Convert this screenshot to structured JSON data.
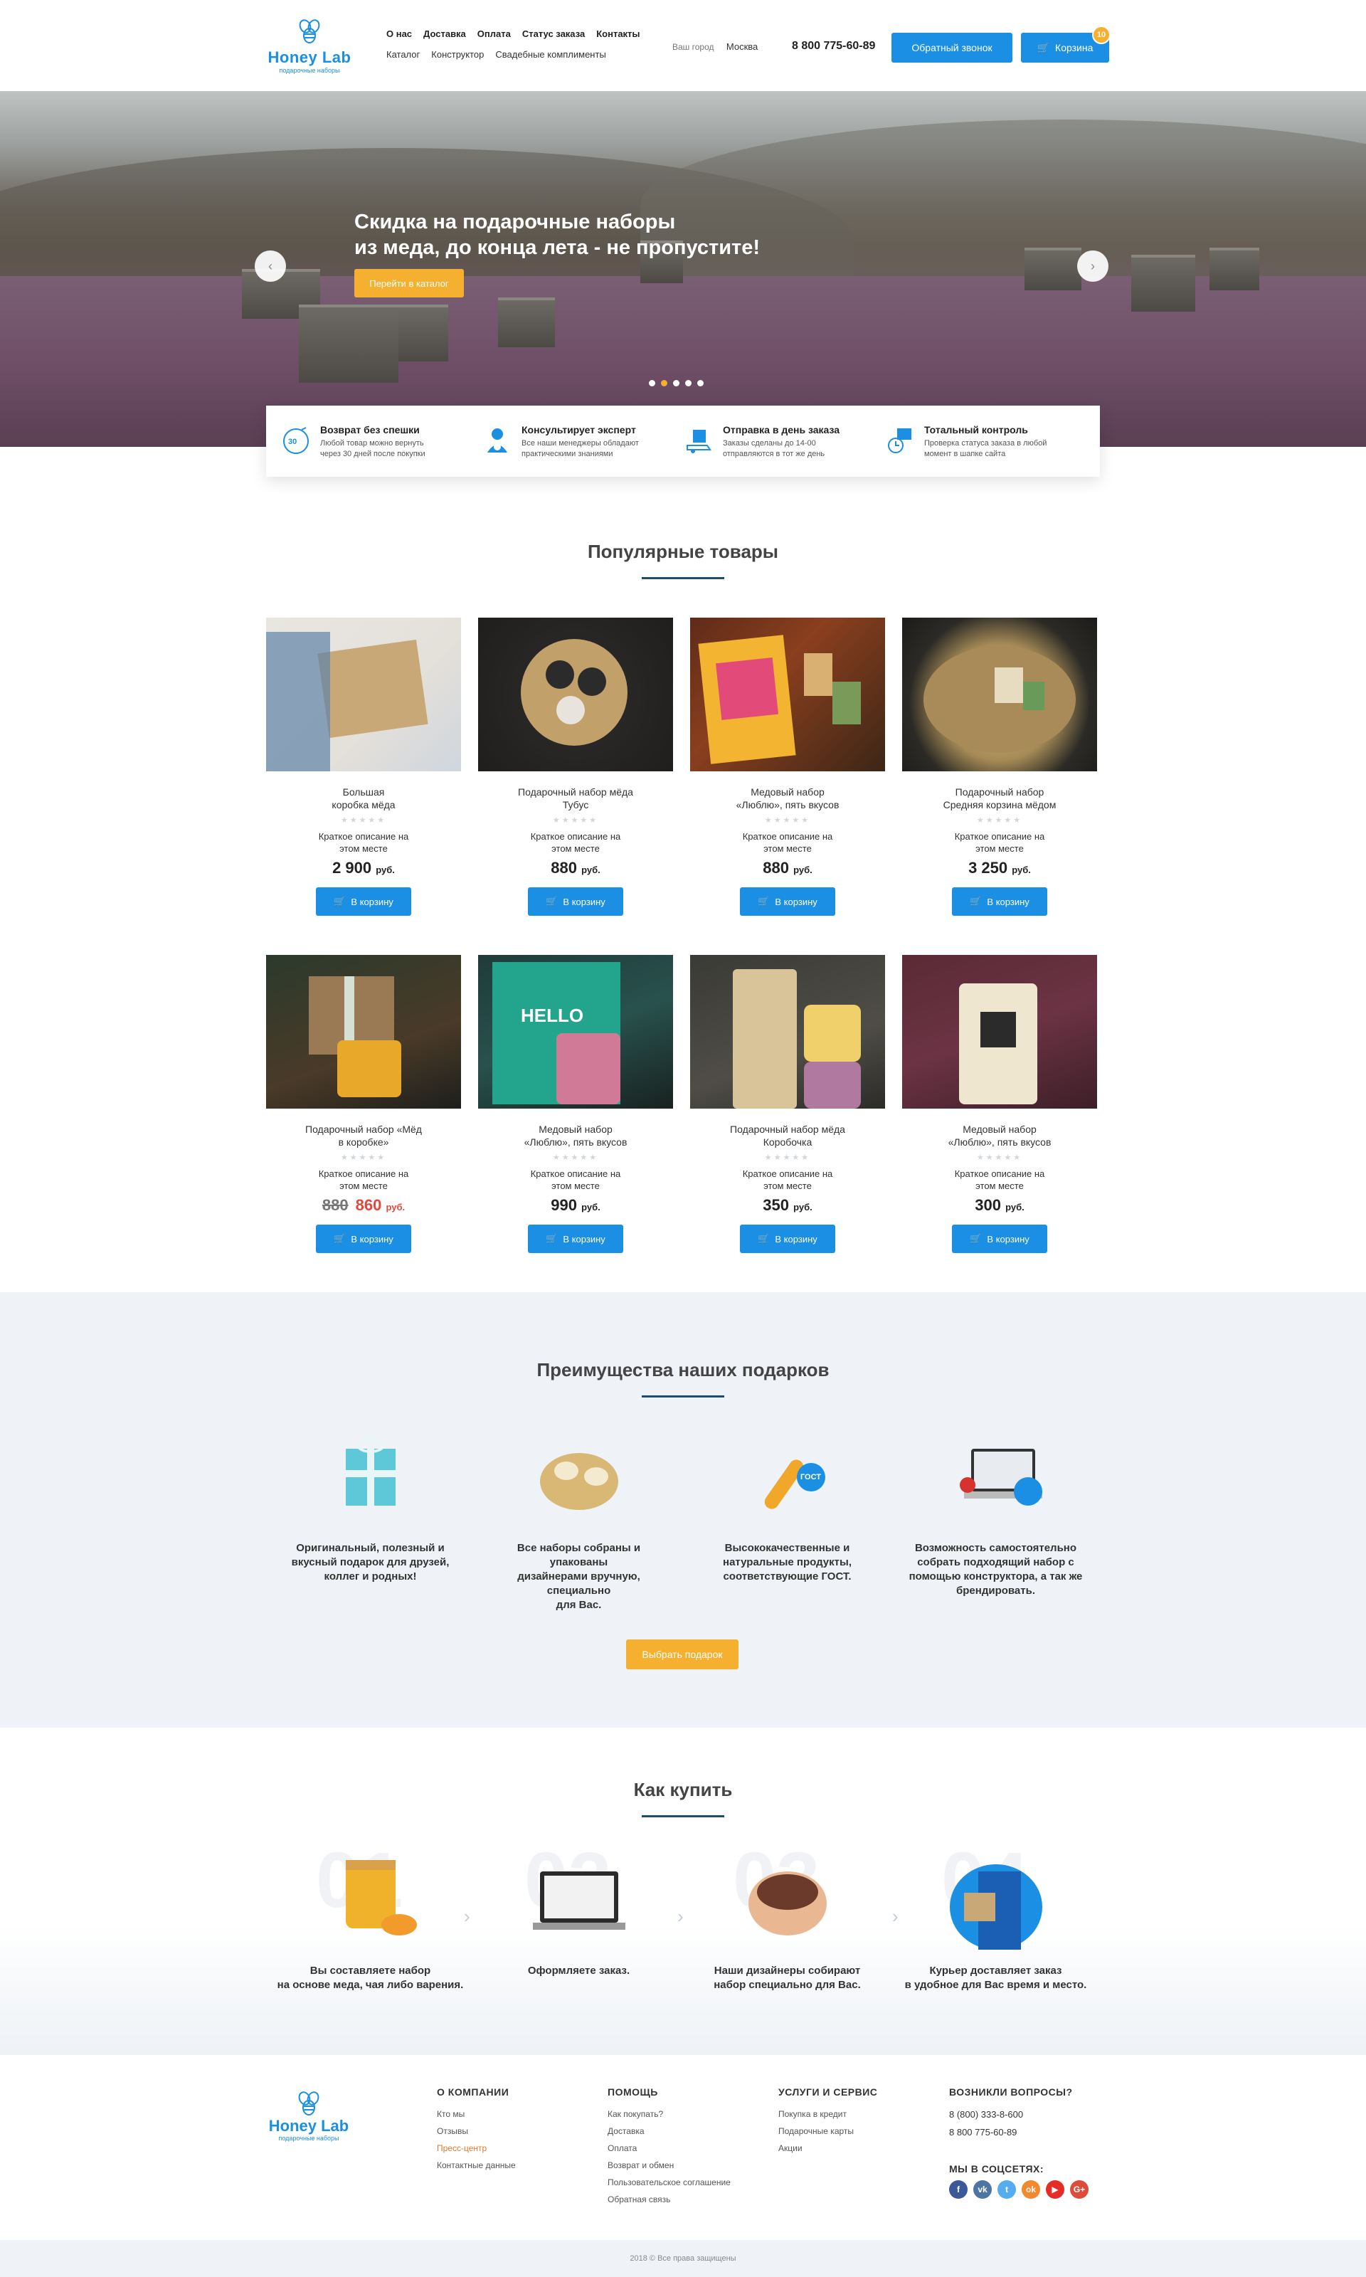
{
  "header": {
    "brand": "Honey Lab",
    "tagline": "подарочные наборы",
    "nav_main": [
      "О нас",
      "Доставка",
      "Оплата",
      "Статус заказа",
      "Контакты"
    ],
    "nav_secondary": [
      "Каталог",
      "Конструктор",
      "Свадебные комплименты"
    ],
    "city_label": "Ваш город",
    "city_value": "Москва",
    "phone": "8 800 775-60-89",
    "callback_label": "Обратный звонок",
    "cart_label": "Корзина",
    "cart_count": "10",
    "accent_color": "#1a8fe3",
    "orange_color": "#f6b02f"
  },
  "hero": {
    "title_line1": "Скидка на подарочные наборы",
    "title_line2": "из меда, до конца лета - не пропустите!",
    "button": "Перейти в каталог",
    "slides": 5,
    "active_slide": 2
  },
  "features": [
    {
      "icon": "30-days-return-icon",
      "title": "Возврат без спешки",
      "text_line1": "Любой товар можно вернуть",
      "text_line2": "через 30 дней после покупки"
    },
    {
      "icon": "expert-consultant-icon",
      "title": "Консультирует эксперт",
      "text_line1": "Все наши менеджеры обладают",
      "text_line2": "практическими знаниями"
    },
    {
      "icon": "same-day-shipping-icon",
      "title": "Отправка в день заказа",
      "text_line1": "Заказы сделаны до 14-00",
      "text_line2": "отправляются в тот же день"
    },
    {
      "icon": "total-control-icon",
      "title": "Тотальный контроль",
      "text_line1": "Проверка статуса заказа в любой",
      "text_line2": "момент в шапке сайта"
    }
  ],
  "popular": {
    "title": "Популярные товары",
    "add_label": "В корзину",
    "currency": "руб.",
    "products": [
      {
        "name1": "Большая",
        "name2": "коробка мёда",
        "desc1": "Краткое описание на",
        "desc2": "этом месте",
        "price": "2 900",
        "old_price": ""
      },
      {
        "name1": "Подарочный набор мёда",
        "name2": "Тубус",
        "desc1": "Краткое описание на",
        "desc2": "этом месте",
        "price": "880",
        "old_price": ""
      },
      {
        "name1": "Медовый набор",
        "name2": "«Люблю», пять вкусов",
        "desc1": "Краткое описание на",
        "desc2": "этом месте",
        "price": "880",
        "old_price": ""
      },
      {
        "name1": "Подарочный набор",
        "name2": "Средняя корзина мёдом",
        "desc1": "Краткое описание на",
        "desc2": "этом месте",
        "price": "3 250",
        "old_price": ""
      },
      {
        "name1": "Подарочный набор «Мёд",
        "name2": "в коробке»",
        "desc1": "Краткое описание на",
        "desc2": "этом месте",
        "price": "860",
        "old_price": "880"
      },
      {
        "name1": "Медовый набор",
        "name2": "«Люблю», пять вкусов",
        "desc1": "Краткое описание на",
        "desc2": "этом месте",
        "price": "990",
        "old_price": ""
      },
      {
        "name1": "Подарочный набор мёда",
        "name2": "Коробочка",
        "desc1": "Краткое описание на",
        "desc2": "этом месте",
        "price": "350",
        "old_price": ""
      },
      {
        "name1": "Медовый набор",
        "name2": "«Люблю», пять вкусов",
        "desc1": "Краткое описание на",
        "desc2": "этом месте",
        "price": "300",
        "old_price": ""
      }
    ]
  },
  "advantages": {
    "title": "Преимущества наших подарков",
    "items": [
      {
        "l1": "Оригинальный, полезный и",
        "l2": "вкусный подарок для друзей,",
        "l3": "коллег и родных!",
        "l4": ""
      },
      {
        "l1": "Все наборы собраны и упакованы",
        "l2": "дизайнерами вручную, специально",
        "l3": "для Вас.",
        "l4": ""
      },
      {
        "l1": "Высококачественные и",
        "l2": "натуральные продукты,",
        "l3": "соответствующие ГОСТ.",
        "l4": ""
      },
      {
        "l1": "Возможность самостоятельно",
        "l2": "собрать подходящий набор с",
        "l3": "помощью конструктора, а так же",
        "l4": "брендировать."
      }
    ],
    "button": "Выбрать подарок",
    "gost": "ГОСТ"
  },
  "howto": {
    "title": "Как купить",
    "steps": [
      {
        "num": "01",
        "l1": "Вы составляете набор",
        "l2": "на основе меда, чая либо варения."
      },
      {
        "num": "02",
        "l1": "Оформляете заказ.",
        "l2": ""
      },
      {
        "num": "03",
        "l1": "Наши дизайнеры собирают",
        "l2": "набор специально для Вас."
      },
      {
        "num": "04",
        "l1": "Курьер доставляет заказ",
        "l2": "в удобное для Вас время и место."
      }
    ]
  },
  "footer": {
    "brand": "Honey Lab",
    "tagline": "подарочные наборы",
    "company": {
      "title": "О КОМПАНИИ",
      "links": [
        "Кто мы",
        "Отзывы",
        "Пресс-центр",
        "Контактные данные"
      ]
    },
    "help": {
      "title": "ПОМОЩЬ",
      "links": [
        "Как покупать?",
        "Доставка",
        "Оплата",
        "Возврат и обмен",
        "Пользовательское соглашение",
        "Обратная связь"
      ]
    },
    "services": {
      "title": "УСЛУГИ И СЕРВИС",
      "links": [
        "Покупка в кредит",
        "Подарочные карты",
        "Акции"
      ]
    },
    "contacts": {
      "title": "ВОЗНИКЛИ ВОПРОСЫ?",
      "phone1": "8 (800) 333-8-600",
      "phone2": "8 800 775-60-89",
      "social_title": "МЫ В СОЦСЕТЯХ:"
    },
    "socials": [
      {
        "name": "facebook-icon",
        "glyph": "f",
        "color": "#3b5998"
      },
      {
        "name": "vk-icon",
        "glyph": "vk",
        "color": "#4c75a3"
      },
      {
        "name": "twitter-icon",
        "glyph": "t",
        "color": "#55acee"
      },
      {
        "name": "odnoklassniki-icon",
        "glyph": "ok",
        "color": "#f2892e"
      },
      {
        "name": "youtube-icon",
        "glyph": "▶",
        "color": "#e52d27"
      },
      {
        "name": "google-plus-icon",
        "glyph": "G+",
        "color": "#dd4b39"
      }
    ],
    "copyright": "2018 © Все права защищены"
  }
}
